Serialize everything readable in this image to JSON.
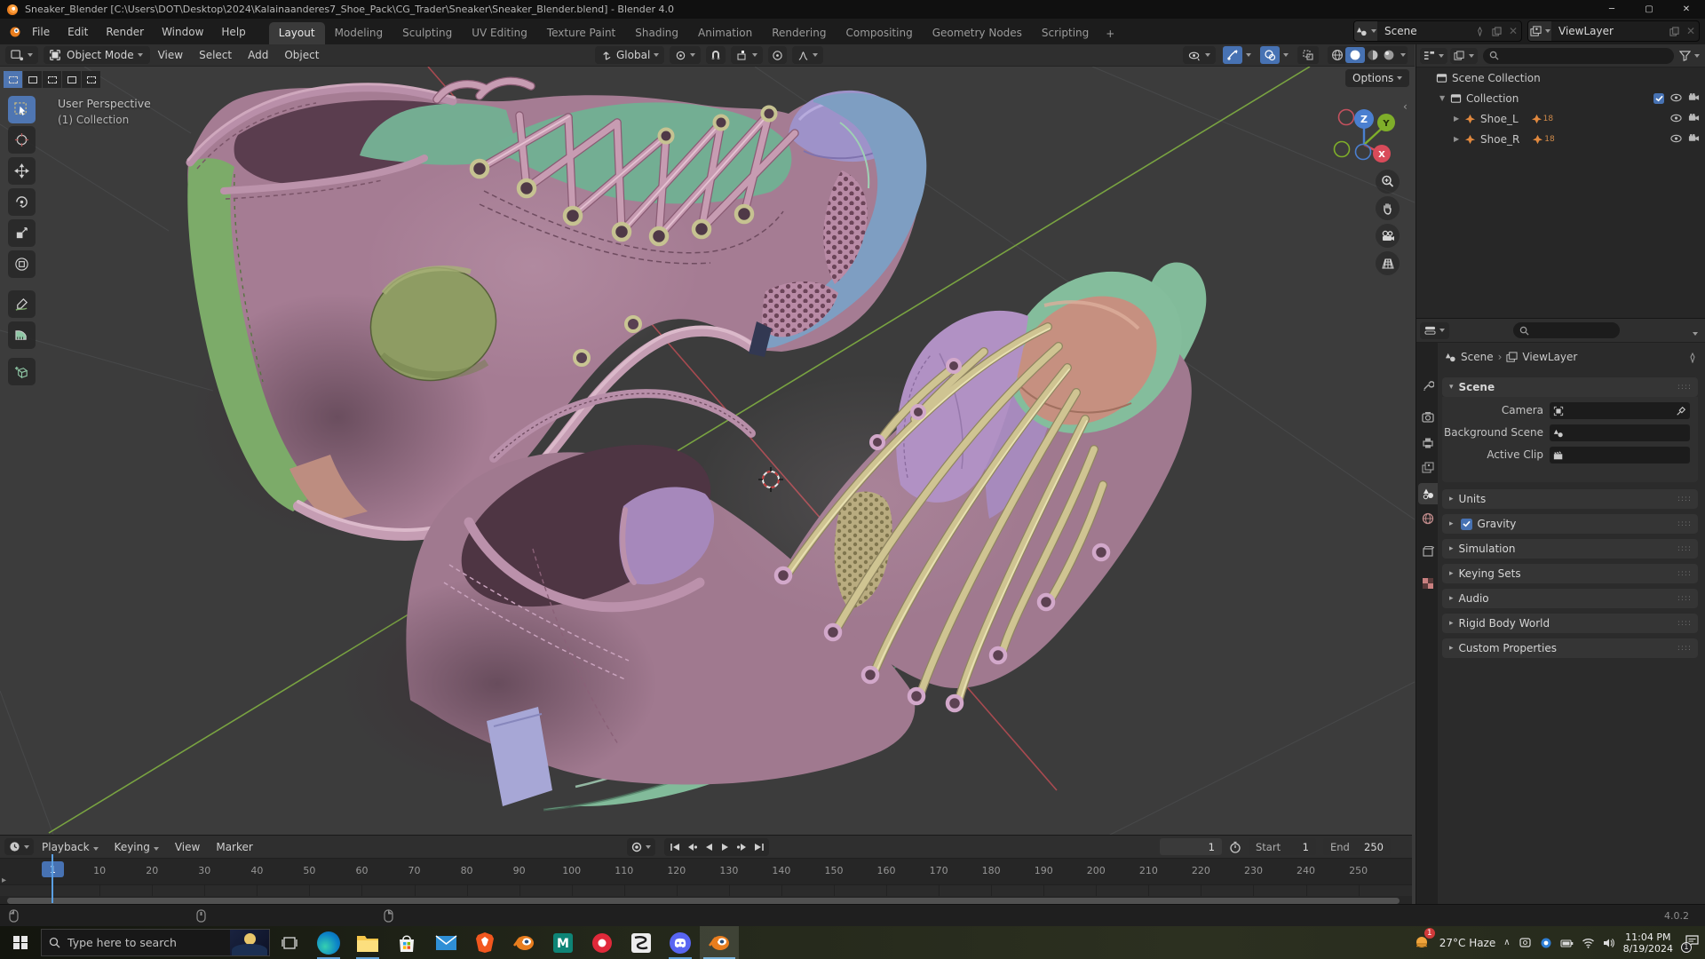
{
  "window": {
    "title": "Sneaker_Blender [C:\\Users\\DOT\\Desktop\\2024\\Kalainaanderes7_Shoe_Pack\\CG_Trader\\Sneaker\\Sneaker_Blender.blend] - Blender 4.0"
  },
  "topbar": {
    "menus": [
      "File",
      "Edit",
      "Render",
      "Window",
      "Help"
    ],
    "workspaces": [
      "Layout",
      "Modeling",
      "Sculpting",
      "UV Editing",
      "Texture Paint",
      "Shading",
      "Animation",
      "Rendering",
      "Compositing",
      "Geometry Nodes",
      "Scripting"
    ],
    "active_workspace": "Layout",
    "add_tab": "+",
    "scene": {
      "label": "Scene"
    },
    "viewlayer": {
      "label": "ViewLayer"
    }
  },
  "viewport_header": {
    "mode": "Object Mode",
    "menus": [
      "View",
      "Select",
      "Add",
      "Object"
    ],
    "orientation": "Global",
    "icons": [
      "editor-type-icon",
      "transform-orientation-icon",
      "pivot-point-icon",
      "snap-magnet-icon",
      "snap-target-icon",
      "proportional-editing-icon",
      "falloff-icon",
      "visibility-icon",
      "gizmos-icon",
      "overlays-icon",
      "xray-icon",
      "shading-wireframe-icon",
      "shading-solid-icon",
      "shading-material-icon",
      "shading-rendered-icon"
    ]
  },
  "viewport": {
    "overlay_line1": "User Perspective",
    "overlay_line2": "(1) Collection",
    "options_label": "Options",
    "gizmo_axes": [
      "Z",
      "Y",
      "X"
    ],
    "nav_icons": [
      "zoom-icon",
      "pan-hand-icon",
      "camera-view-icon",
      "grid-persp-icon"
    ],
    "tools": [
      "select-box-tool",
      "cursor-tool",
      "move-tool",
      "rotate-tool",
      "scale-tool",
      "transform-tool",
      "annotate-tool",
      "measure-tool",
      "add-cube-tool"
    ],
    "scene_colors": {
      "body_mauve": "#a57c93",
      "teal": "#73ae93",
      "green_stripe": "#7cab69",
      "logo_olive": "#8e9c63",
      "lace_pink": "#c79cb2",
      "lace_khaki": "#cfc492",
      "toe_purple": "#9e92c9",
      "toe_blue": "#7e9ec2",
      "toe_peach": "#c69080",
      "sole_mint": "#82bb9a",
      "axis_red": "#a84a50",
      "axis_green": "#76a03f"
    }
  },
  "outliner": {
    "rows": [
      {
        "label": "Scene Collection",
        "level": 0,
        "icon": "collection-icon",
        "disclosure": "",
        "badge": ""
      },
      {
        "label": "Collection",
        "level": 1,
        "icon": "collection-icon",
        "disclosure": "down",
        "badge": "",
        "checkbox": true
      },
      {
        "label": "Shoe_L",
        "level": 2,
        "icon": "object-icon",
        "disclosure": "right",
        "badge": "18"
      },
      {
        "label": "Shoe_R",
        "level": 2,
        "icon": "object-icon",
        "disclosure": "right",
        "badge": "18"
      }
    ]
  },
  "properties": {
    "breadcrumb": {
      "scene": "Scene",
      "viewlayer": "ViewLayer"
    },
    "tab_icons": [
      "tool-icon",
      "render-icon",
      "output-icon",
      "viewlayer-icon",
      "scene-icon",
      "world-icon",
      "object-icon",
      "texture-icon"
    ],
    "scene_panel": {
      "title": "Scene",
      "fields": [
        {
          "label": "Camera"
        },
        {
          "label": "Background Scene"
        },
        {
          "label": "Active Clip"
        }
      ]
    },
    "panels": [
      "Units",
      "Gravity",
      "Simulation",
      "Keying Sets",
      "Audio",
      "Rigid Body World",
      "Custom Properties"
    ],
    "gravity_checked": true
  },
  "timeline": {
    "menus": [
      "Playback",
      "Keying",
      "View",
      "Marker"
    ],
    "frames": [
      10,
      20,
      30,
      40,
      50,
      60,
      70,
      80,
      90,
      100,
      110,
      120,
      130,
      140,
      150,
      160,
      170,
      180,
      190,
      200,
      210,
      220,
      230,
      240,
      250
    ],
    "current_frame": "1",
    "frame_badge": "1",
    "start_label": "Start",
    "start_value": "1",
    "end_label": "End",
    "end_value": "250",
    "play_icons": [
      "jump-start-icon",
      "prev-keyframe-icon",
      "play-reverse-icon",
      "play-icon",
      "next-keyframe-icon",
      "jump-end-icon",
      "record-icon"
    ]
  },
  "statusbar": {
    "version": "4.0.2",
    "mouse_hints": [
      "left-mouse-icon",
      "middle-mouse-icon",
      "right-mouse-icon"
    ]
  },
  "taskbar": {
    "search_placeholder": "Type here to search",
    "apps": [
      "edge",
      "file-explorer",
      "store",
      "mail",
      "brave",
      "blender",
      "maya",
      "red-app",
      "zbrush",
      "discord",
      "blender-active"
    ],
    "weather": "27°C Haze",
    "tray_icons": [
      "tray-chevron-icon",
      "onedrive-icon",
      "cortana-icon",
      "battery-icon",
      "wifi-icon",
      "volume-icon"
    ],
    "time": "11:04 PM",
    "date": "8/19/2024",
    "notif_badge": "1"
  }
}
